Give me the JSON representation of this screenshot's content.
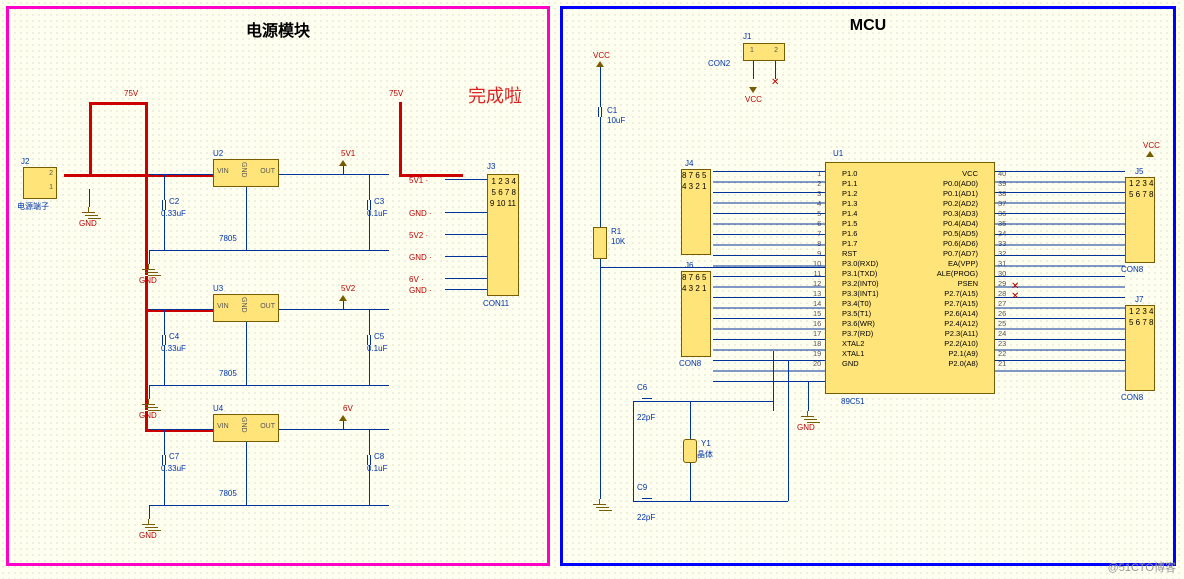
{
  "overlay_text": "完成啦",
  "watermark": "@51CTO博客",
  "left_block": {
    "title": "电源模块",
    "rails": {
      "p75v_a": "75V",
      "p75v_b": "75V"
    },
    "J2": {
      "ref": "J2",
      "type": "电源端子",
      "pins": [
        "2",
        "1"
      ]
    },
    "J3": {
      "ref": "J3",
      "type": "CON11",
      "pins": [
        "1",
        "2",
        "3",
        "4",
        "5",
        "6",
        "7",
        "8",
        "9",
        "10",
        "11"
      ],
      "nets": [
        "5V1",
        "",
        "",
        "GND",
        "",
        "5V2",
        "",
        "GND",
        "",
        "6V",
        "GND"
      ]
    },
    "regulators": [
      {
        "ref": "U2",
        "type": "7805",
        "in_cap": {
          "ref": "C2",
          "val": "0.33uF"
        },
        "out_cap": {
          "ref": "C3",
          "val": "0.1uF"
        },
        "out_net": "5V1"
      },
      {
        "ref": "U3",
        "type": "7805",
        "in_cap": {
          "ref": "C4",
          "val": "0.33uF"
        },
        "out_cap": {
          "ref": "C5",
          "val": "0.1uF"
        },
        "out_net": "5V2"
      },
      {
        "ref": "U4",
        "type": "7805",
        "in_cap": {
          "ref": "C7",
          "val": "0.33uF"
        },
        "out_cap": {
          "ref": "C8",
          "val": "0.1uF"
        },
        "out_net": "6V"
      }
    ],
    "reg_pin_labels": {
      "vin": "VIN",
      "gnd": "GND",
      "out": "OUT"
    },
    "gnd_label": "GND"
  },
  "right_block": {
    "title": "MCU",
    "vcc_label": "VCC",
    "J1": {
      "ref": "J1",
      "type": "CON2",
      "pins": [
        "1",
        "2"
      ]
    },
    "C1": {
      "ref": "C1",
      "val": "10uF"
    },
    "R1": {
      "ref": "R1",
      "val": "10K"
    },
    "C6": {
      "ref": "C6",
      "val": "22pF"
    },
    "C9": {
      "ref": "C9",
      "val": "22pF"
    },
    "Y1": {
      "ref": "Y1",
      "val": "晶体"
    },
    "U1": {
      "ref": "U1",
      "type": "89C51",
      "left_pins": [
        {
          "n": "1",
          "name": "P1.0"
        },
        {
          "n": "2",
          "name": "P1.1"
        },
        {
          "n": "3",
          "name": "P1.2"
        },
        {
          "n": "4",
          "name": "P1.3"
        },
        {
          "n": "5",
          "name": "P1.4"
        },
        {
          "n": "6",
          "name": "P1.5"
        },
        {
          "n": "7",
          "name": "P1.6"
        },
        {
          "n": "8",
          "name": "P1.7"
        },
        {
          "n": "9",
          "name": "RST"
        },
        {
          "n": "10",
          "name": "P3.0(RXD)"
        },
        {
          "n": "11",
          "name": "P3.1(TXD)"
        },
        {
          "n": "12",
          "name": "P3.2(INT0)"
        },
        {
          "n": "13",
          "name": "P3.3(INT1)"
        },
        {
          "n": "14",
          "name": "P3.4(T0)"
        },
        {
          "n": "15",
          "name": "P3.5(T1)"
        },
        {
          "n": "16",
          "name": "P3.6(WR)"
        },
        {
          "n": "17",
          "name": "P3.7(RD)"
        },
        {
          "n": "18",
          "name": "XTAL2"
        },
        {
          "n": "19",
          "name": "XTAL1"
        },
        {
          "n": "20",
          "name": "GND"
        }
      ],
      "right_pins": [
        {
          "n": "40",
          "name": "VCC"
        },
        {
          "n": "39",
          "name": "P0.0(AD0)"
        },
        {
          "n": "38",
          "name": "P0.1(AD1)"
        },
        {
          "n": "37",
          "name": "P0.2(AD2)"
        },
        {
          "n": "36",
          "name": "P0.3(AD3)"
        },
        {
          "n": "35",
          "name": "P0.4(AD4)"
        },
        {
          "n": "34",
          "name": "P0.5(AD5)"
        },
        {
          "n": "33",
          "name": "P0.6(AD6)"
        },
        {
          "n": "32",
          "name": "P0.7(AD7)"
        },
        {
          "n": "31",
          "name": "EA(VPP)"
        },
        {
          "n": "30",
          "name": "ALE(PROG)"
        },
        {
          "n": "29",
          "name": "PSEN"
        },
        {
          "n": "28",
          "name": "P2.7(A15)"
        },
        {
          "n": "27",
          "name": "P2.7(A15)"
        },
        {
          "n": "26",
          "name": "P2.6(A14)"
        },
        {
          "n": "25",
          "name": "P2.4(A12)"
        },
        {
          "n": "24",
          "name": "P2.3(A11)"
        },
        {
          "n": "23",
          "name": "P2.2(A10)"
        },
        {
          "n": "22",
          "name": "P2.1(A9)"
        },
        {
          "n": "21",
          "name": "P2.0(A8)"
        }
      ]
    },
    "J4": {
      "ref": "J4",
      "type": "CON8",
      "pins": [
        "8",
        "7",
        "6",
        "5",
        "4",
        "3",
        "2",
        "1"
      ]
    },
    "J6": {
      "ref": "J6",
      "type": "CON8",
      "pins": [
        "8",
        "7",
        "6",
        "5",
        "4",
        "3",
        "2",
        "1"
      ]
    },
    "J5": {
      "ref": "J5",
      "type": "CON8",
      "pins": [
        "1",
        "2",
        "3",
        "4",
        "5",
        "6",
        "7",
        "8"
      ]
    },
    "J7": {
      "ref": "J7",
      "type": "CON8",
      "pins": [
        "1",
        "2",
        "3",
        "4",
        "5",
        "6",
        "7",
        "8"
      ]
    }
  },
  "chart_data": {
    "type": "table",
    "description": "Electronic schematic, two functional blocks.",
    "blocks": [
      {
        "name": "电源模块 (Power module)",
        "connectors": [
          "J2 电源端子 (2-pin)",
          "J3 CON11 (11-pin, nets 5V1/GND/5V2/GND/6V/GND)"
        ],
        "regulators": [
          {
            "ref": "U2",
            "part": "7805",
            "Cin": "C2 0.33uF",
            "Cout": "C3 0.1uF",
            "net_out": "5V1"
          },
          {
            "ref": "U3",
            "part": "7805",
            "Cin": "C4 0.33uF",
            "Cout": "C5 0.1uF",
            "net_out": "5V2"
          },
          {
            "ref": "U4",
            "part": "7805",
            "Cin": "C7 0.33uF",
            "Cout": "C8 0.1uF",
            "net_out": "6V"
          }
        ],
        "input_rail": "75V"
      },
      {
        "name": "MCU",
        "ic": {
          "ref": "U1",
          "part": "89C51",
          "pins": 40
        },
        "reset": {
          "cap": "C1 10uF",
          "pullup": "R1 10K"
        },
        "crystal": {
          "ref": "Y1 晶体",
          "caps": [
            "C6 22pF",
            "C9 22pF"
          ]
        },
        "headers": [
          "J1 CON2",
          "J4 CON8",
          "J5 CON8",
          "J6 CON8",
          "J7 CON8"
        ],
        "power": "VCC"
      }
    ]
  }
}
